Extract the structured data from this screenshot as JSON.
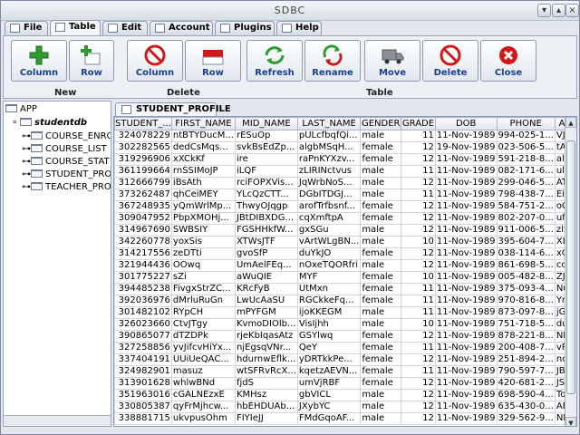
{
  "window": {
    "title": "SDBC"
  },
  "menu_tabs": [
    {
      "label": "File"
    },
    {
      "label": "Table"
    },
    {
      "label": "Edit"
    },
    {
      "label": "Account"
    },
    {
      "label": "Plugins"
    },
    {
      "label": "Help"
    }
  ],
  "toolbar": {
    "buttons": [
      {
        "label": "Column",
        "icon": "plus-icon"
      },
      {
        "label": "Row",
        "icon": "plus-row-icon"
      },
      {
        "label": "Column",
        "icon": "delete-column-icon"
      },
      {
        "label": "Row",
        "icon": "delete-row-icon"
      },
      {
        "label": "Refresh",
        "icon": "refresh-icon"
      },
      {
        "label": "Rename",
        "icon": "rename-icon"
      },
      {
        "label": "Move",
        "icon": "truck-icon"
      },
      {
        "label": "Delete",
        "icon": "delete-icon"
      },
      {
        "label": "Close",
        "icon": "close-icon"
      }
    ],
    "groups": {
      "new": "New",
      "delete": "Delete",
      "table": "Table"
    }
  },
  "tree": {
    "root": "APP",
    "db": "studentdb",
    "items": [
      "COURSE_ENRO",
      "COURSE_LIST",
      "COURSE_STAT",
      "STUDENT_PRO",
      "TEACHER_PRO"
    ]
  },
  "table_tab": "STUDENT_PROFILE",
  "columns": [
    "STUDENT_...",
    "FIRST_NAME",
    "MID_NAME",
    "LAST_NAME",
    "GENDER",
    "GRADE",
    "DOB",
    "PHONE",
    "AD"
  ],
  "rows": [
    [
      "324078229",
      "ntBTYDucM...",
      "rESuOp",
      "pULcfbqfQi...",
      "male",
      "11",
      "11-Nov-1989",
      "994-025-1...",
      "VJz"
    ],
    [
      "302282565",
      "dedCsMqs...",
      "svkBsEdZp...",
      "algbMSqH...",
      "female",
      "12",
      "19-Nov-1989",
      "023-506-5...",
      "tAF"
    ],
    [
      "319296906",
      "xXCkKf",
      "ire",
      "raPnKYXzv...",
      "female",
      "12",
      "11-Nov-1989",
      "591-218-8...",
      "alE"
    ],
    [
      "361199664",
      "rnSSIMoJP",
      "iLQF",
      "zLIRINctvus",
      "male",
      "11",
      "11-Nov-1989",
      "082-171-6...",
      "ulV"
    ],
    [
      "312666799",
      "iBsAth",
      "rciFOPXVis...",
      "JqWrbNoS...",
      "male",
      "12",
      "11-Nov-1989",
      "299-046-5...",
      "ATs"
    ],
    [
      "373262487",
      "qhCeiMEY",
      "YLcQzCTT...",
      "DGbITDGJ...",
      "male",
      "11",
      "11-Nov-1989",
      "798-438-7...",
      "EiZ"
    ],
    [
      "367248935",
      "yQmWrlMp...",
      "ThwyOJqgp",
      "arofTrfbsnf...",
      "female",
      "12",
      "11-Nov-1989",
      "584-751-2...",
      "oCV"
    ],
    [
      "309047952",
      "PbpXMOHj...",
      "JBtDIBXDG...",
      "cqXmftpA",
      "female",
      "12",
      "11-Nov-1989",
      "802-207-0...",
      "ufie"
    ],
    [
      "314967690",
      "SWBSIY",
      "FGSHHkfW...",
      "gxSGu",
      "male",
      "12",
      "11-Nov-1989",
      "911-006-5...",
      "zlS"
    ],
    [
      "342260778",
      "yoxSis",
      "XTWsJTF",
      "vArtWLgBN...",
      "male",
      "10",
      "11-Nov-1989",
      "395-604-7...",
      "XLp"
    ],
    [
      "314217556",
      "zeDTti",
      "gvoSfP",
      "duYkJO",
      "female",
      "12",
      "11-Nov-1989",
      "038-114-6...",
      "xQ"
    ],
    [
      "321944436",
      "OOwq",
      "UmAelFEq...",
      "nOxeTQORfri",
      "male",
      "12",
      "11-Nov-1989",
      "861-698-5...",
      "ccE"
    ],
    [
      "301775227",
      "sZi",
      "aWuQIE",
      "MYF",
      "female",
      "10",
      "11-Nov-1989",
      "005-482-8...",
      "ZJv"
    ],
    [
      "394485238",
      "FivgxStrZC...",
      "KRcFyB",
      "UtMxn",
      "female",
      "11",
      "11-Nov-1989",
      "375-093-4...",
      "Nui"
    ],
    [
      "392036976",
      "dMrluRuGn",
      "LwUcAaSU",
      "RGCkkeFq...",
      "female",
      "11",
      "11-Nov-1989",
      "970-816-8...",
      "YnL"
    ],
    [
      "301482102",
      "RYpCH",
      "mPYFGM",
      "ijoKKEGM",
      "male",
      "11",
      "11-Nov-1989",
      "873-097-8...",
      "jGV"
    ],
    [
      "326023660",
      "CtvJTgy",
      "KvmoDIOlb...",
      "VisIjhh",
      "male",
      "10",
      "11-Nov-1989",
      "751-718-5...",
      "duN"
    ],
    [
      "390865077",
      "dTZDPk",
      "rjeKbIqasAtz",
      "GSYlwq",
      "female",
      "12",
      "11-Nov-1989",
      "878-221-8...",
      "NDt"
    ],
    [
      "327258856",
      "yvJifcvHiYx...",
      "njEgsqVNr...",
      "QeY",
      "female",
      "11",
      "11-Nov-1989",
      "200-408-7...",
      "vPF"
    ],
    [
      "337404191",
      "UUiUeQAC...",
      "hdurnwEflk...",
      "yDRTkkPe...",
      "female",
      "12",
      "11-Nov-1989",
      "251-894-2...",
      "ncF"
    ],
    [
      "324982901",
      "masuz",
      "wtSFRvRcX...",
      "kqetzAEVN...",
      "female",
      "11",
      "11-Nov-1989",
      "790-597-7...",
      "JBG"
    ],
    [
      "313901628",
      "whlwBNd",
      "fjdS",
      "umVjRBF",
      "female",
      "12",
      "11-Nov-1989",
      "420-681-2...",
      "JSV"
    ],
    [
      "351963016",
      "cGALNEzxE",
      "KMHsz",
      "gbVICL",
      "male",
      "12",
      "11-Nov-1989",
      "698-590-4...",
      "Tov"
    ],
    [
      "330805387",
      "qyFrMjhcw...",
      "hbEHDUAb...",
      "JXybYC",
      "male",
      "12",
      "11-Nov-1989",
      "635-430-0...",
      "AEz"
    ],
    [
      "338881715",
      "ukvpusOhm",
      "FIYIeJJ",
      "FMdGqoAF...",
      "male",
      "12",
      "11-Nov-1989",
      "329-562-9...",
      "NIT"
    ]
  ]
}
